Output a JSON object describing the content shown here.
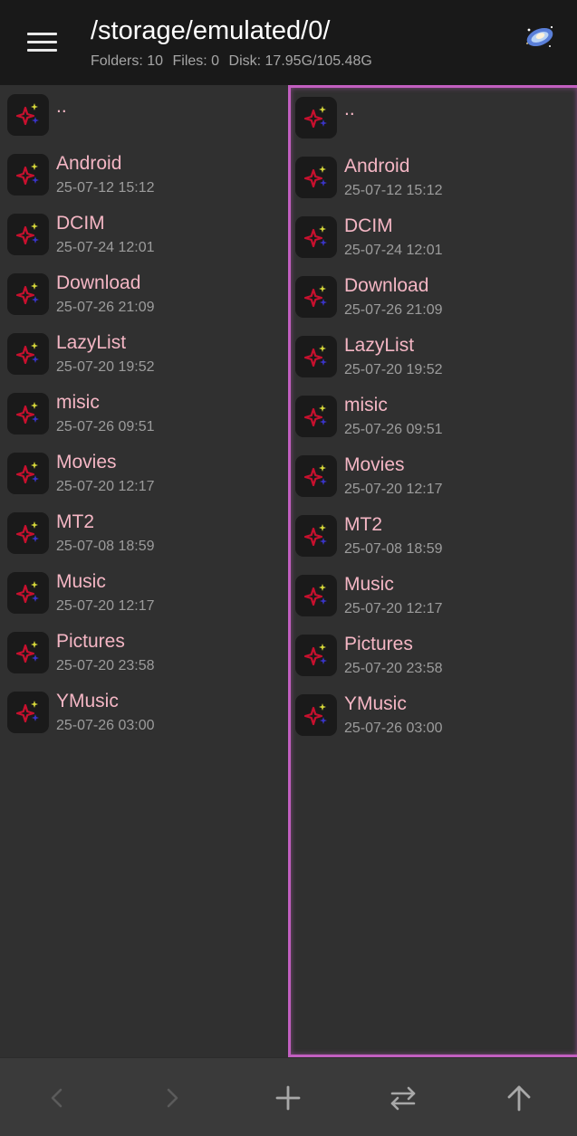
{
  "header": {
    "path": "/storage/emulated/0/",
    "folders": "Folders: 10",
    "files": "Files: 0",
    "disk": "Disk: 17.95G/105.48G",
    "menu_icon": "hamburger-menu-icon",
    "logo_icon": "galaxy-logo-icon"
  },
  "colors": {
    "header_bg": "#191919",
    "panel_bg": "#303030",
    "active_border": "#c25fc0",
    "name_text": "#f4b6c4",
    "date_text": "#9c9c9c",
    "icon_star_red": "#c8102e",
    "icon_star_yellow": "#d6d83a",
    "icon_star_blue": "#3a34c8"
  },
  "panels": [
    {
      "id": "left",
      "active": false,
      "items": [
        {
          "name": "..",
          "date": ""
        },
        {
          "name": "Android",
          "date": "25-07-12 15:12"
        },
        {
          "name": "DCIM",
          "date": "25-07-24 12:01"
        },
        {
          "name": "Download",
          "date": "25-07-26 21:09"
        },
        {
          "name": "LazyList",
          "date": "25-07-20 19:52"
        },
        {
          "name": "misic",
          "date": "25-07-26 09:51"
        },
        {
          "name": "Movies",
          "date": "25-07-20 12:17"
        },
        {
          "name": "MT2",
          "date": "25-07-08 18:59"
        },
        {
          "name": "Music",
          "date": "25-07-20 12:17"
        },
        {
          "name": "Pictures",
          "date": "25-07-20 23:58"
        },
        {
          "name": "YMusic",
          "date": "25-07-26 03:00"
        }
      ]
    },
    {
      "id": "right",
      "active": true,
      "items": [
        {
          "name": "..",
          "date": ""
        },
        {
          "name": "Android",
          "date": "25-07-12 15:12"
        },
        {
          "name": "DCIM",
          "date": "25-07-24 12:01"
        },
        {
          "name": "Download",
          "date": "25-07-26 21:09"
        },
        {
          "name": "LazyList",
          "date": "25-07-20 19:52"
        },
        {
          "name": "misic",
          "date": "25-07-26 09:51"
        },
        {
          "name": "Movies",
          "date": "25-07-20 12:17"
        },
        {
          "name": "MT2",
          "date": "25-07-08 18:59"
        },
        {
          "name": "Music",
          "date": "25-07-20 12:17"
        },
        {
          "name": "Pictures",
          "date": "25-07-20 23:58"
        },
        {
          "name": "YMusic",
          "date": "25-07-26 03:00"
        }
      ]
    }
  ],
  "bottom_bar": {
    "buttons": [
      {
        "icon": "chevron-left-icon",
        "enabled": false
      },
      {
        "icon": "chevron-right-icon",
        "enabled": false
      },
      {
        "icon": "plus-icon",
        "enabled": true
      },
      {
        "icon": "swap-arrows-icon",
        "enabled": true
      },
      {
        "icon": "arrow-up-icon",
        "enabled": true
      }
    ]
  }
}
